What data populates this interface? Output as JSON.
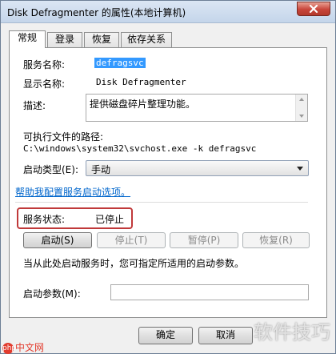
{
  "window": {
    "title": "Disk Defragmenter 的属性(本地计算机)"
  },
  "tabs": [
    {
      "label": "常规",
      "active": true
    },
    {
      "label": "登录",
      "active": false
    },
    {
      "label": "恢复",
      "active": false
    },
    {
      "label": "依存关系",
      "active": false
    }
  ],
  "general": {
    "service_name_label": "服务名称:",
    "service_name_value": "defragsvc",
    "display_name_label": "显示名称:",
    "display_name_value": "Disk Defragmenter",
    "description_label": "描述:",
    "description_value": "提供磁盘碎片整理功能。",
    "exe_path_label": "可执行文件的路径:",
    "exe_path_value": "C:\\windows\\system32\\svchost.exe -k defragsvc",
    "startup_type_label": "启动类型(E):",
    "startup_type_value": "手动",
    "help_link": "帮助我配置服务启动选项。",
    "service_status_label": "服务状态:",
    "service_status_value": "已停止",
    "buttons": {
      "start": "启动(S)",
      "stop": "停止(T)",
      "pause": "暂停(P)",
      "resume": "恢复(R)"
    },
    "hint": "当从此处启动服务时，您可指定所适用的启动参数。",
    "start_params_label": "启动参数(M):",
    "start_params_value": ""
  },
  "footer": {
    "ok": "确定",
    "cancel": "取消"
  },
  "watermarks": {
    "left": "中文网",
    "left_logo": "php",
    "right": "软件技巧"
  },
  "colors": {
    "selection": "#3399ff",
    "highlight_border": "#c0393a",
    "link": "#0066cc"
  }
}
